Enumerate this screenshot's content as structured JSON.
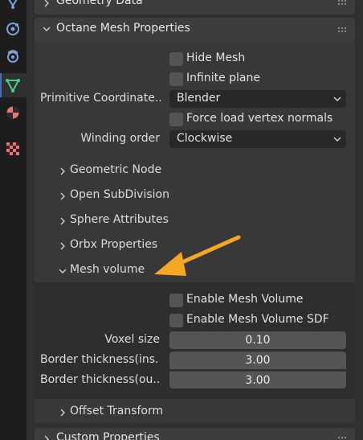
{
  "panels": {
    "geometry_data": "Geometry Data",
    "octane_mesh": "Octane Mesh Properties",
    "custom_properties": "Custom Properties"
  },
  "props": {
    "hide_mesh": "Hide Mesh",
    "infinite_plane": "Infinite plane",
    "primitive_coord_label": "Primitive Coordinate...",
    "primitive_coord_value": "Blender",
    "force_load_normals": "Force load vertex normals",
    "winding_order_label": "Winding order",
    "winding_order_value": "Clockwise"
  },
  "subpanels": {
    "geometric_node": "Geometric Node",
    "open_subdivision": "Open SubDivision",
    "sphere_attributes": "Sphere Attributes",
    "orbx_properties": "Orbx Properties",
    "mesh_volume": "Mesh volume",
    "offset_transform": "Offset Transform"
  },
  "mesh_volume": {
    "enable_mesh_volume": "Enable Mesh Volume",
    "enable_mesh_volume_sdf": "Enable Mesh Volume SDF",
    "voxel_size_label": "Voxel size",
    "voxel_size_value": "0.10",
    "border_in_label": "Border thickness(ins...",
    "border_in_value": "3.00",
    "border_out_label": "Border thickness(ou...",
    "border_out_value": "3.00"
  },
  "colors": {
    "accent_arrow": "#f5a623",
    "editor_bg": "#303030",
    "panel_header": "#3d3d3d",
    "panel_body": "#383838",
    "field": "#545454",
    "dropdown": "#282828"
  },
  "icons": [
    "object-data-icon",
    "physics-icon",
    "constraints-icon",
    "mesh-data-icon",
    "material-icon",
    "texture-icon"
  ]
}
